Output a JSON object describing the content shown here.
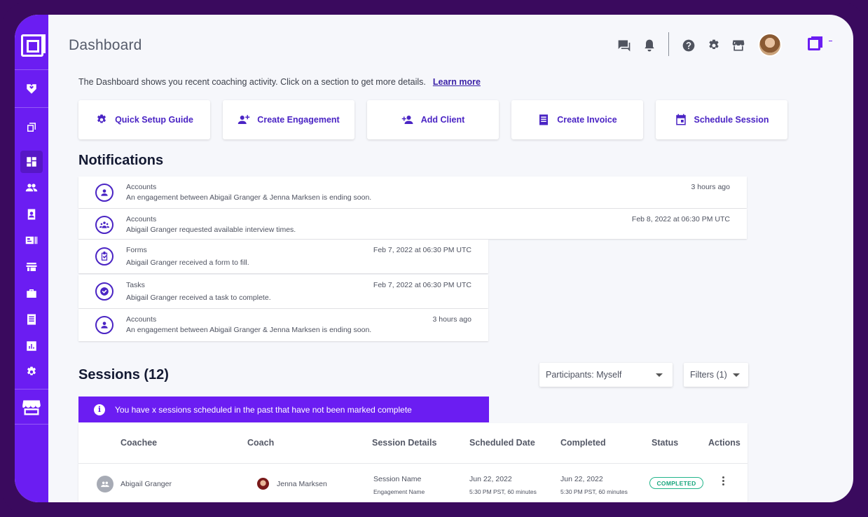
{
  "header": {
    "title": "Dashboard",
    "icons": [
      "chat-icon",
      "bell-icon",
      "help-icon",
      "gear-icon",
      "storefront-icon"
    ]
  },
  "sidebar": {
    "items": [
      {
        "icon": "hands-heart-icon"
      },
      {
        "icon": "layers-icon"
      },
      {
        "icon": "dashboard-icon",
        "active": true
      },
      {
        "icon": "people-icon"
      },
      {
        "icon": "contact-book-icon"
      },
      {
        "icon": "id-card-icon"
      },
      {
        "icon": "store-icon"
      },
      {
        "icon": "briefcase-icon"
      },
      {
        "icon": "receipt-icon"
      },
      {
        "icon": "bar-chart-icon"
      },
      {
        "icon": "gear-icon"
      },
      {
        "icon": "marketplace-icon"
      }
    ]
  },
  "intro": {
    "text": "The Dashboard shows you recent coaching activity. Click on  a section to get more details.",
    "link": "Learn more"
  },
  "quick_actions": [
    {
      "label": "Quick Setup Guide",
      "icon": "gear-icon"
    },
    {
      "label": "Create Engagement",
      "icon": "people-add-icon"
    },
    {
      "label": "Add Client",
      "icon": "person-add-icon"
    },
    {
      "label": "Create Invoice",
      "icon": "receipt-icon"
    },
    {
      "label": "Schedule Session",
      "icon": "calendar-icon"
    }
  ],
  "notifications": {
    "title": "Notifications",
    "items": [
      {
        "category": "Accounts",
        "message": "An engagement between Abigail Granger & Jenna Marksen is ending soon.",
        "time": "3 hours ago",
        "icon": "account-circle-icon"
      },
      {
        "category": "Accounts",
        "message": "Abigail Granger requested available interview times.",
        "time": "Feb 8, 2022 at 06:30 PM UTC",
        "icon": "group-circle-icon"
      },
      {
        "category": "Forms",
        "message": "Abigail Granger received a form to fill.",
        "time": "Feb 7, 2022 at 06:30 PM UTC",
        "icon": "clipboard-check-icon"
      },
      {
        "category": "Tasks",
        "message": "Abigail Granger received a task to complete.",
        "time": "Feb 7, 2022 at 06:30 PM UTC",
        "icon": "check-circle-icon"
      },
      {
        "category": "Accounts",
        "message": "An engagement between Abigail Granger & Jenna Marksen is ending soon.",
        "time": "3 hours ago",
        "icon": "account-circle-icon"
      }
    ]
  },
  "sessions": {
    "title": "Sessions (12)",
    "participants_filter": "Participants: Myself",
    "filters": "Filters (1)",
    "alert": "You have x sessions scheduled in the past that have not been marked complete",
    "columns": [
      "Coachee",
      "Coach",
      "Session Details",
      "Scheduled Date",
      "Completed",
      "Status",
      "Actions"
    ],
    "rows": [
      {
        "coachee": "Abigail Granger",
        "coach": "Jenna Marksen",
        "session_name": "Session Name",
        "engagement_name": "Engagement Name",
        "scheduled_date": "Jun 22, 2022",
        "scheduled_time": "5:30 PM PST, 60 minutes",
        "completed_date": "Jun 22, 2022",
        "completed_time": "5:30 PM PST, 60 minutes",
        "status": "COMPLETED"
      }
    ]
  }
}
